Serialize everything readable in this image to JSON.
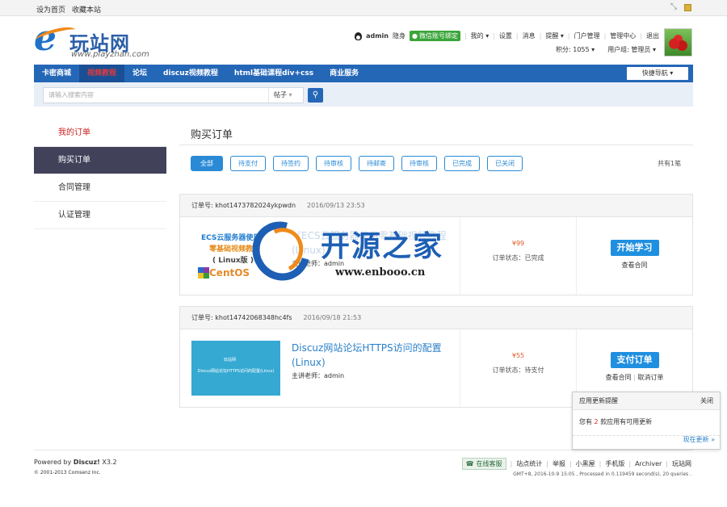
{
  "topbar": {
    "set_home": "设为首页",
    "bookmark": "收藏本站"
  },
  "logo": {
    "letter": "e",
    "name": "玩站网",
    "url": "www.playzhan.com"
  },
  "user": {
    "name": "admin",
    "invisible": "隐身",
    "wechat": "微信账号绑定",
    "links": [
      "我的",
      "设置",
      "消息",
      "提醒",
      "门户管理",
      "管理中心",
      "退出"
    ],
    "points": "积分: 1055",
    "group": "用户组: 管理员"
  },
  "nav": {
    "items": [
      "卡密商城",
      "视频教程",
      "论坛",
      "discuz视频教程",
      "html基础课程div+css",
      "商业服务"
    ],
    "quick": "快捷导航"
  },
  "search": {
    "placeholder": "请输入搜索内容",
    "type": "帖子"
  },
  "sidebar": {
    "items": [
      "我的订单",
      "购买订单",
      "合同管理",
      "认证管理"
    ]
  },
  "page": {
    "title": "购买订单",
    "total": "共有1笔"
  },
  "filters": [
    "全部",
    "待支付",
    "待签约",
    "待审核",
    "待邮寄",
    "待审核",
    "已完成",
    "已关闭"
  ],
  "orders": [
    {
      "no_label": "订单号:",
      "no": "khot1473782024ykpwdn",
      "date": "2016/09/13 23:53",
      "thumb": {
        "line1": "ECS云服务器使用",
        "line2": "零基础视频教程",
        "line3": "( Linux版 )",
        "line4": "CentOS"
      },
      "title": "《ECS云服务器使用零基础视频教程(Linux)》",
      "teacher": "主讲老师：admin",
      "price": "¥99",
      "status": "订单状态：已完成",
      "action": "开始学习",
      "links": [
        "查看合同"
      ]
    },
    {
      "no_label": "订单号:",
      "no": "khot14742068348hc4fs",
      "date": "2016/09/18 21:53",
      "thumb": {
        "line1": "玩站网",
        "line2": "Discuz网站论坛HTTPS访问的配置(Linux)"
      },
      "title": "Discuz网站论坛HTTPS访问的配置(Linux)",
      "teacher": "主讲老师：admin",
      "price": "¥55",
      "status": "订单状态：待支付",
      "action": "支付订单",
      "links": [
        "查看合同",
        "取消订单"
      ]
    }
  ],
  "watermark": {
    "text": "开源之家",
    "url": "www.enbooo.cn"
  },
  "popup": {
    "title": "应用更新提醒",
    "close": "关闭",
    "pre": "您有",
    "count": "2",
    "post": "款应用有可用更新",
    "action": "现在更新 »"
  },
  "footer": {
    "powered_pre": "Powered by",
    "powered_name": "Discuz!",
    "powered_ver": "X3.2",
    "copyright": "© 2001-2013 Comsenz Inc.",
    "service": "在线客服",
    "links": [
      "站点统计",
      "举报",
      "小黑屋",
      "手机版",
      "Archiver",
      "玩站网"
    ],
    "info": "GMT+8, 2016-10-9 15:05 , Processed in 0.119459 second(s), 20 queries ."
  }
}
